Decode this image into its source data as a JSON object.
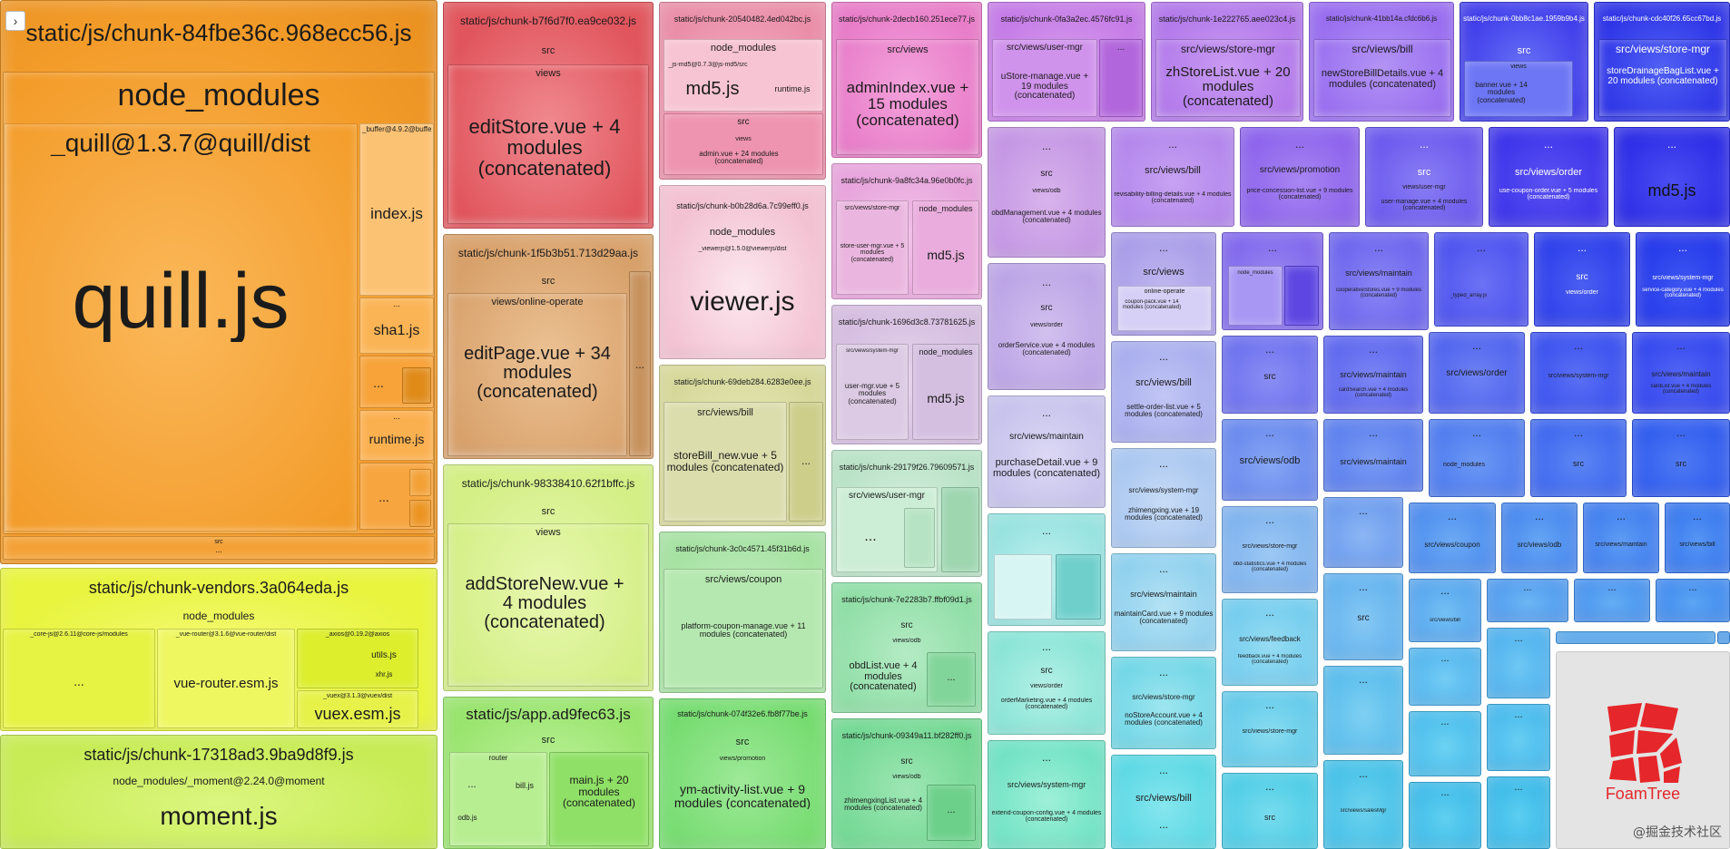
{
  "ui": {
    "sidebar_toggle": "›",
    "watermark": "@掘金技术社区",
    "logo_text": "FoamTree"
  },
  "colors": {
    "orange": "#f7a12a",
    "red": "#e8666e",
    "pink": "#f0a4b8",
    "magenta": "#e68ad6",
    "purple": "#b98be6",
    "violet": "#8f66f0",
    "blue": "#4a54f4",
    "cyan": "#67d9e6",
    "green": "#8fdd88",
    "yellow": "#eaf64a",
    "lime": "#c8ef60",
    "logo_red": "#e5262a"
  },
  "modules": {
    "chunk84": {
      "title": "static/js/chunk-84fbe36c.968ecc56.js",
      "node_modules": "node_modules",
      "quill_dist": "_quill@1.3.7@quill/dist",
      "quill": "quill.js",
      "buffer": "_buffer@4.9.2@buffer",
      "index": "index.js",
      "sha1": "sha1.js",
      "runtime": "runtime.js",
      "dots": "...",
      "src": "src"
    },
    "vendors": {
      "title": "static/js/chunk-vendors.3a064eda.js",
      "node_modules": "node_modules",
      "core_js": "_core-js@2.6.11@core-js/modules",
      "vue_router_path": "_vue-router@3.1.6@vue-router/dist",
      "vue_router": "vue-router.esm.js",
      "axios_path": "_axios@0.19.2@axios",
      "utils": "utils.js",
      "xhr": "xhr.js",
      "vuex_path": "_vuex@3.1.3@vuex/dist",
      "vuex": "vuex.esm.js",
      "dots": "..."
    },
    "chunk17318": {
      "title": "static/js/chunk-17318ad3.9ba9d8f9.js",
      "moment_path": "node_modules/_moment@2.24.0@moment",
      "moment": "moment.js"
    },
    "chunkb7f": {
      "title": "static/js/chunk-b7f6d7f0.ea9ce032.js",
      "src": "src",
      "views": "views",
      "main": "editStore.vue + 4 modules (concatenated)"
    },
    "chunk1f5": {
      "title": "static/js/chunk-1f5b3b51.713d29aa.js",
      "src": "src",
      "views": "views/online-operate",
      "main": "editPage.vue + 34 modules (concatenated)",
      "dots": "..."
    },
    "chunk983": {
      "title": "static/js/chunk-98338410.62f1bffc.js",
      "src": "src",
      "views": "views",
      "main": "addStoreNew.vue + 4 modules (concatenated)"
    },
    "app": {
      "title": "static/js/app.ad9fec63.js",
      "src": "src",
      "router": "router",
      "bill": "bill.js",
      "odb": "odb.js",
      "main": "main.js + 20 modules (concatenated)",
      "dots": "..."
    },
    "chunk205": {
      "title": "static/js/chunk-20540482.4ed042bc.js",
      "node_modules": "node_modules",
      "md5_path": "_js-md5@0.7.3@js-md5/src",
      "md5": "md5.js",
      "runtime": "runtime.js",
      "src": "src",
      "views": "views",
      "admin": "admin.vue + 24 modules (concatenated)"
    },
    "chunkb0b": {
      "title": "static/js/chunk-b0b28d6a.7c99eff0.js",
      "node_modules": "node_modules",
      "viewer_path": "_viewerjs@1.5.0@viewerjs/dist",
      "viewer": "viewer.js"
    },
    "chunk69d": {
      "title": "static/js/chunk-69deb284.6283e0ee.js",
      "bill": "src/views/bill",
      "main": "storeBill_new.vue + 5 modules (concatenated)",
      "dots": "..."
    },
    "chunk3c0": {
      "title": "static/js/chunk-3c0c4571.45f31b6d.js",
      "coupon": "src/views/coupon",
      "main": "platform-coupon-manage.vue + 11 modules (concatenated)"
    },
    "chunk074": {
      "title": "static/js/chunk-074f32e6.fb8f77be.js",
      "src": "src",
      "promotion": "views/promotion",
      "main": "ym-activity-list.vue + 9 modules (concatenated)"
    },
    "chunk2de": {
      "title": "static/js/chunk-2decb160.251ece77.js",
      "views": "src/views",
      "main": "adminIndex.vue + 15 modules (concatenated)"
    },
    "chunk9a8": {
      "title": "static/js/chunk-9a8fc34a.96e0b0fc.js",
      "store_mgr": "src/views/store-mgr",
      "store_user": "store-user-mgr.vue + 5 modules (concatenated)",
      "node_modules": "node_modules",
      "md5": "md5.js"
    },
    "chunk169": {
      "title": "static/js/chunk-1696d3c8.73781625.js",
      "system_mgr": "src/views/system-mgr",
      "user_mgr": "user-mgr.vue + 5 modules (concatenated)",
      "node_modules": "node_modules",
      "md5": "md5.js"
    },
    "chunk291": {
      "title": "static/js/chunk-29179f26.79609571.js",
      "user_mgr": "src/views/user-mgr",
      "dots": "..."
    },
    "chunk7e2": {
      "title": "static/js/chunk-7e2283b7.ffbf09d1.js",
      "src": "src",
      "views": "views/odb",
      "main": "obdList.vue + 4 modules (concatenated)",
      "dots": "..."
    },
    "chunk093": {
      "title": "static/js/chunk-09349a11.bf282ff0.js",
      "src": "src",
      "views": "views/odb",
      "main": "zhimengxingList.vue + 4 modules (concatenated)",
      "dots": "..."
    },
    "chunk0fa": {
      "title": "static/js/chunk-0fa3a2ec.4576fc91.js",
      "user_mgr": "src/views/user-mgr",
      "main": "uStore-manage.vue + 19 modules (concatenated)",
      "dots": "..."
    },
    "chunk1e2": {
      "title": "static/js/chunk-1e222765.aee023c4.js",
      "store_mgr": "src/views/store-mgr",
      "main": "zhStoreList.vue + 20 modules (concatenated)"
    },
    "chunk41b": {
      "title": "static/js/chunk-41bb14a.cfdc6b6.js",
      "bill": "src/views/bill",
      "main": "newStoreBillDetails.vue + 4 modules (concatenated)"
    },
    "chunk0bb": {
      "title": "static/js/chunk-0bb8c1ae.1959b9b4.js",
      "src": "src",
      "views": "views",
      "main": "banner.vue + 14 modules (concatenated)"
    },
    "chunkcdc": {
      "title": "static/js/chunk-cdc40f26.65cc67bd.js",
      "store_mgr": "src/views/store-mgr",
      "main": "storeDrainageBagList.vue + 20 modules (concatenated)"
    },
    "grid": {
      "dots": "...",
      "src": "src",
      "odb_views": "views/odb",
      "obd_mgmt": "obdManagement.vue + 4 modules (concatenated)",
      "order_views": "views/order",
      "order_service": "orderService.vue + 4 modules (concatenated)",
      "maintain": "src/views/maintain",
      "purchase": "purchaseDetail.vue + 9 modules (concatenated)",
      "order_marketing": "orderMarketing.vue + 4 modules (concatenated)",
      "system_mgr": "src/views/system-mgr",
      "extend_coupon": "extend-coupon-config.vue + 4 modules (concatenated)",
      "bill": "src/views/bill",
      "revisability": "revisability-billing-details.vue + 4 modules (concatenated)",
      "views": "src/views",
      "online_operate": "online-operate",
      "coupon_pack": "coupon-pack.vue + 14 modules (concatenated)",
      "settle": "settle-order-list.vue + 5 modules (concatenated)",
      "zhimengxing": "zhimengxing.vue + 19 modules (concatenated)",
      "maintain_card": "maintainCard.vue + 9 modules (concatenated)",
      "store_mgr": "src/views/store-mgr",
      "no_store": "noStoreAccount.vue + 4 modules (concatenated)",
      "promotion": "src/views/promotion",
      "price_concession": "price-concession-list.vue + 9 modules (concatenated)",
      "node_modules": "node_modules",
      "odb": "src/views/odb",
      "obd_statistics": "obd-statistics.vue + 4 modules (concatenated)",
      "feedback": "src/views/feedback",
      "feedback_vue": "feedback.vue + 4 modules (concatenated)",
      "user_views": "views/user-mgr",
      "user_manage": "user-manage.vue + 4 modules (concatenated)",
      "cooperative": "cooperativeStores.vue + 9 modules (concatenated)",
      "typed_array": "_typed_array.js",
      "card_search": "cardSearch.vue + 4 modules (concatenated)",
      "order": "src/views/order",
      "coupon": "src/views/coupon",
      "sales_mgr": "src/views/salesMgr",
      "use_coupon": "use-coupon-order.vue + 5 modules (concatenated)",
      "service_category": "service-category.vue + 4 modules (concatenated)",
      "card_list": "cardList.vue + 4 modules (concatenated)",
      "md5": "md5.js"
    }
  }
}
